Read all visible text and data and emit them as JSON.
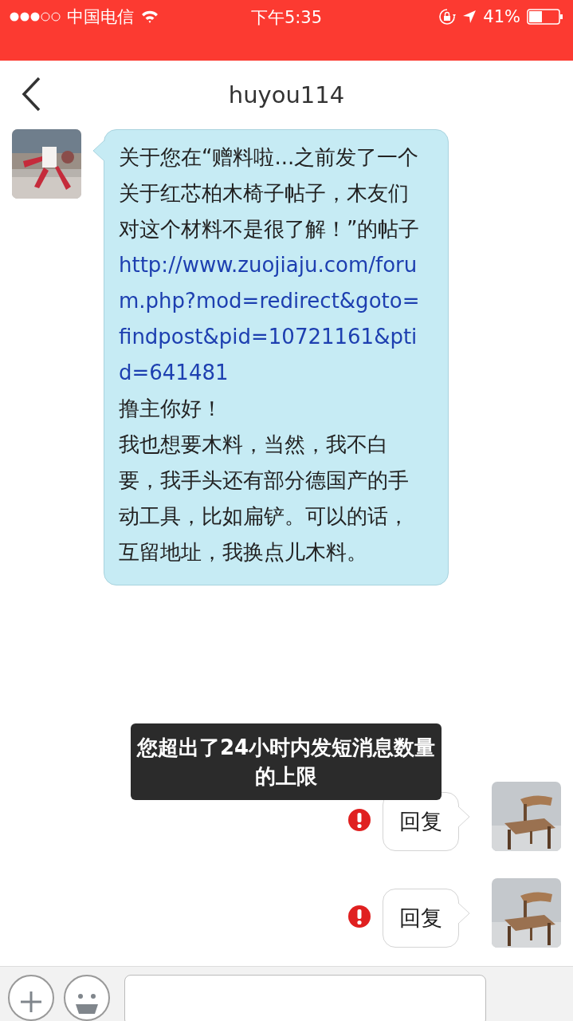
{
  "status_bar": {
    "carrier": "中国电信",
    "time": "下午5:35",
    "battery": "41%"
  },
  "nav": {
    "title": "huyou114"
  },
  "messages": [
    {
      "kind": "incoming",
      "intro": "关于您在“赠料啦...之前发了一个关于红芯柏木椅子帖子，木友们对这个材料不是很了解！”的帖子",
      "link": "http://www.zuojiaju.com/forum.php?mod=redirect&goto=findpost&pid=10721161&ptid=641481",
      "lines": [
        "撸主你好！",
        "我也想要木料，当然，我不白要，我手头还有部分德国产的手动工具，比如扁铲。可以的话，互留地址，我换点儿木料。"
      ]
    },
    {
      "kind": "outgoing",
      "text": "回复",
      "failed": true
    },
    {
      "kind": "outgoing",
      "text": "回复",
      "failed": true
    }
  ],
  "toast": {
    "text": "您超出了24小时内发短消息数量的上限"
  }
}
